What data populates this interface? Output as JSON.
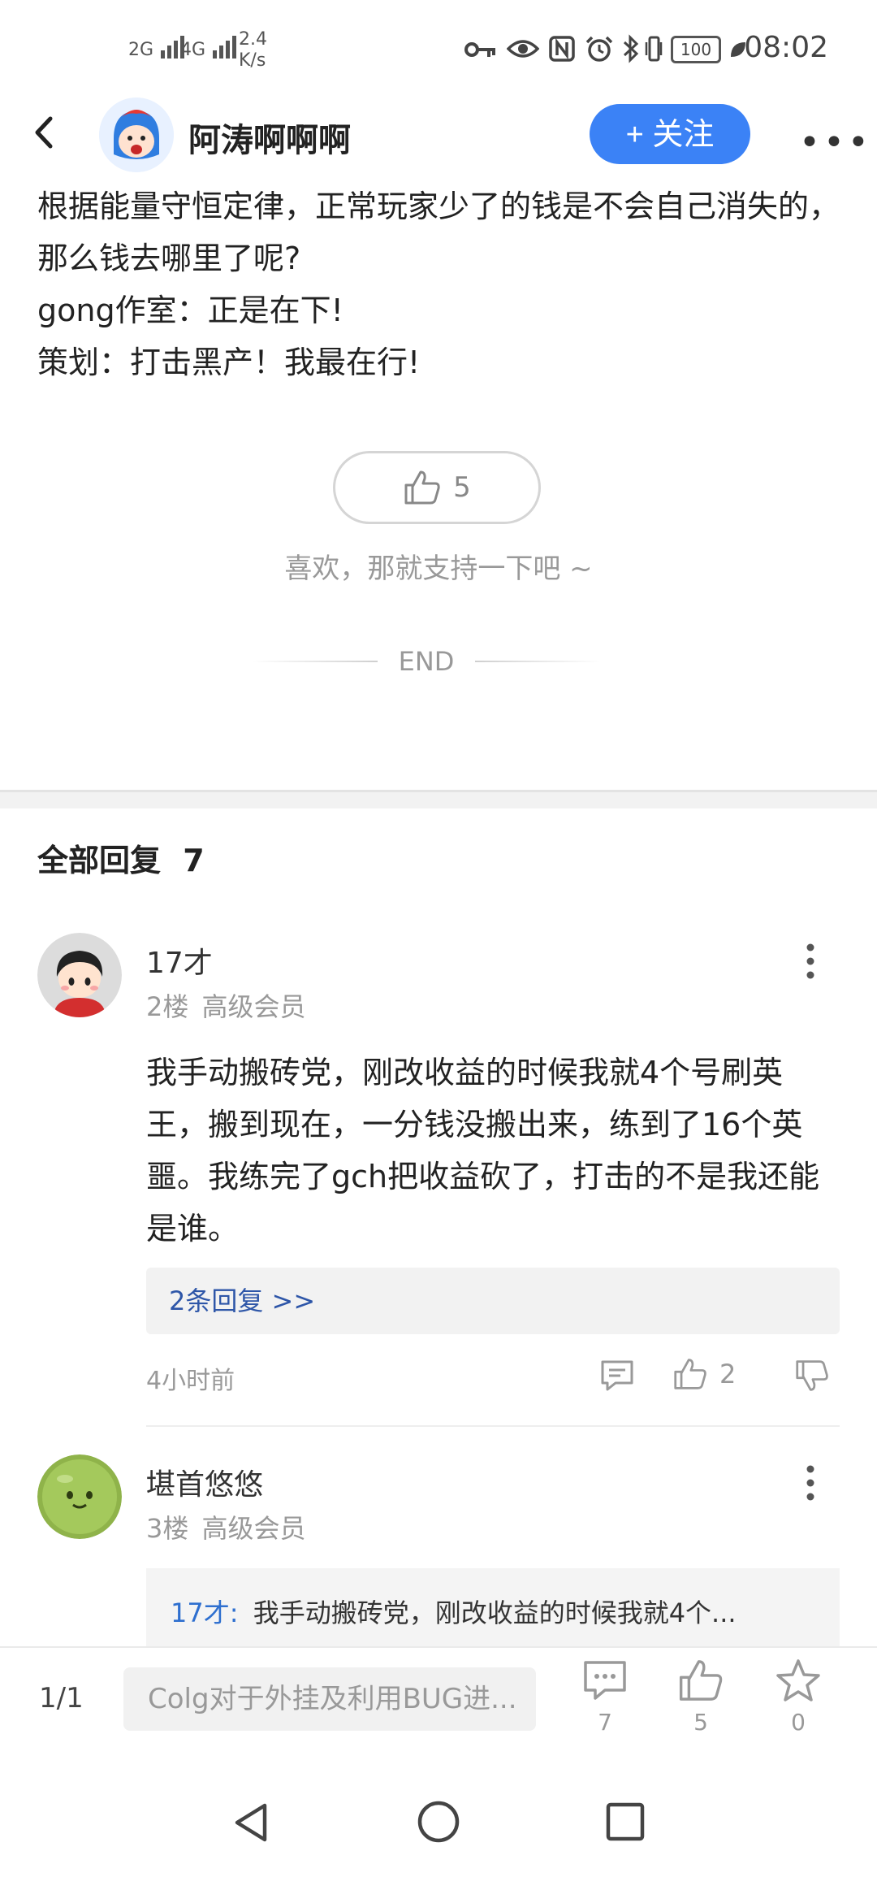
{
  "status_bar": {
    "signal_1": "2G",
    "signal_2": "4G",
    "speed": "2.4",
    "speed_unit": "K/s",
    "battery": "100",
    "time": "08:02"
  },
  "header": {
    "username": "阿涛啊啊啊",
    "follow_label": "+ 关注"
  },
  "post": {
    "lines": [
      "根据能量守恒定律，正常玩家少了的钱是不会自己消失的，那么钱去哪里了呢?",
      "gong作室：正是在下!",
      "策划：打击黑产！我最在行!"
    ],
    "like_count": "5",
    "support_text": "喜欢，那就支持一下吧 ~",
    "end_label": "END"
  },
  "replies": {
    "title": "全部回复",
    "count": "7",
    "items": [
      {
        "name": "17才",
        "floor": "2楼",
        "level": "高级会员",
        "text": "我手动搬砖党，刚改收益的时候我就4个号刷英王，搬到现在，一分钱没搬出来，练到了16个英噩。我练完了gch把收益砍了，打击的不是我还能是谁。",
        "sub_reply_label": "2条回复 >>",
        "time": "4小时前",
        "likes": "2"
      },
      {
        "name": "堪首悠悠",
        "floor": "3楼",
        "level": "高级会员",
        "quote_user": "17才:",
        "quote_text": "我手动搬砖党，刚改收益的时候我就4个..."
      }
    ]
  },
  "bottom_bar": {
    "page_indicator": "1/1",
    "input_placeholder": "Colg对于外挂及利用BUG进...",
    "comments_count": "7",
    "likes_count": "5",
    "favorites_count": "0"
  }
}
